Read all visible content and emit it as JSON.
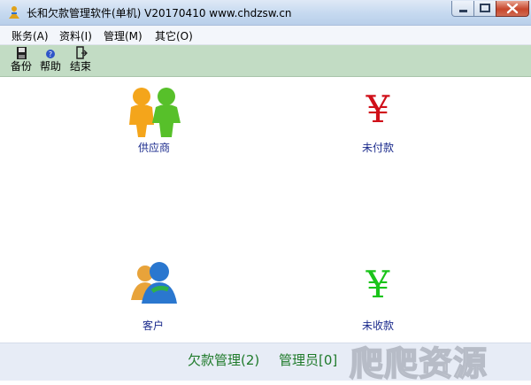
{
  "window": {
    "title": "长和欠款管理软件(单机) V20170410 www.chdzsw.cn"
  },
  "menu": {
    "items": [
      "账务(A)",
      "资料(I)",
      "管理(M)",
      "其它(O)"
    ]
  },
  "toolbar": {
    "backup_label": "备份",
    "help_label": "帮助",
    "exit_label": "结束"
  },
  "tiles": {
    "suppliers_label": "供应商",
    "unpaid_label": "未付款",
    "customers_label": "客户",
    "unreceived_label": "未收款",
    "unpaid_symbol": "¥",
    "unreceived_symbol": "¥"
  },
  "status": {
    "debt_mgmt": "欠款管理(2)",
    "admin": "管理员[0]"
  },
  "watermark": "爬爬资源",
  "colors": {
    "unpaid_yen": "#d0101a",
    "unreceived_yen": "#19c419",
    "toolbar_bg": "#c2dcc4",
    "status_text": "#1f7a2a",
    "tile_label": "#1a2a8c"
  },
  "icons": {
    "app": "app-person-icon",
    "suppliers": "two-people-icon",
    "customers": "messenger-users-icon",
    "backup": "floppy-disk-icon",
    "help": "help-icon",
    "exit": "exit-door-icon"
  }
}
